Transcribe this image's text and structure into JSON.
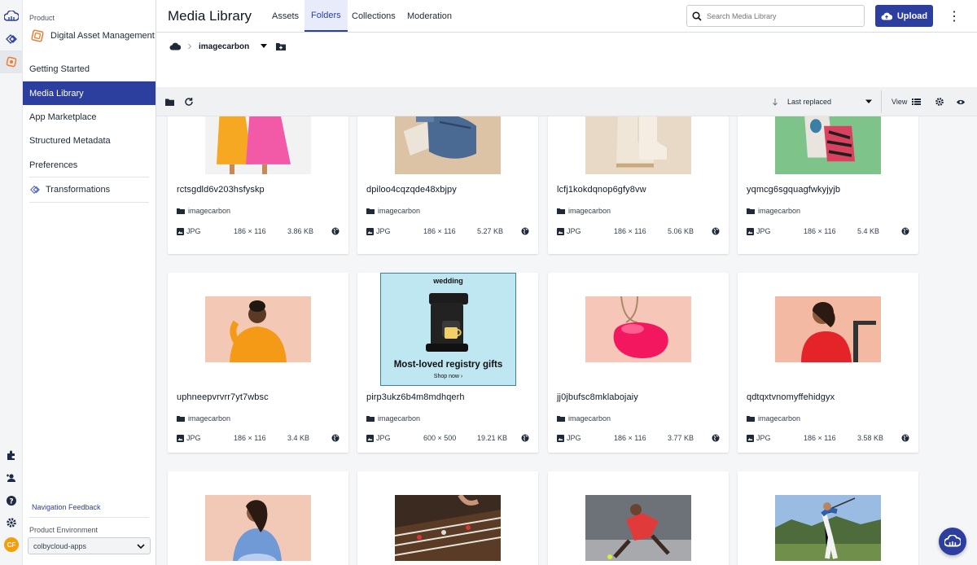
{
  "app": {
    "product_label": "Product",
    "product_name": "Digital Asset Management"
  },
  "sidebar": {
    "items": [
      {
        "label": "Getting Started"
      },
      {
        "label": "Media Library"
      },
      {
        "label": "App Marketplace"
      },
      {
        "label": "Structured Metadata"
      },
      {
        "label": "Preferences"
      },
      {
        "label": "Transformations"
      }
    ],
    "nav_feedback": "Navigation Feedback",
    "env_label": "Product Environment",
    "env_value": "colbycloud-apps",
    "avatar_initials": "CF"
  },
  "header": {
    "title": "Media Library",
    "tabs": [
      {
        "label": "Assets"
      },
      {
        "label": "Folders"
      },
      {
        "label": "Collections"
      },
      {
        "label": "Moderation"
      }
    ],
    "search_placeholder": "Search Media Library",
    "upload_label": "Upload"
  },
  "breadcrumb": {
    "folder": "imagecarbon"
  },
  "toolbar": {
    "sort_label": "Last replaced",
    "view_label": "View"
  },
  "assets": [
    {
      "name": "rctsgdld6v203hsfyskp",
      "folder": "imagecarbon",
      "format": "JPG",
      "dims": "186 × 116",
      "size": "3.86 KB"
    },
    {
      "name": "dpiloo4cqzqde48xbjpy",
      "folder": "imagecarbon",
      "format": "JPG",
      "dims": "186 × 116",
      "size": "5.27 KB"
    },
    {
      "name": "lcfj1kokdqnop6gfy8vw",
      "folder": "imagecarbon",
      "format": "JPG",
      "dims": "186 × 116",
      "size": "5.06 KB"
    },
    {
      "name": "yqmcg6sgquagfwkyjyjb",
      "folder": "imagecarbon",
      "format": "JPG",
      "dims": "186 × 116",
      "size": "5.4 KB"
    },
    {
      "name": "uphneepvrvrr7yt7wbsc",
      "folder": "imagecarbon",
      "format": "JPG",
      "dims": "186 × 116",
      "size": "3.4 KB"
    },
    {
      "name": "pirp3ukz6b4m8mdhqerh",
      "folder": "imagecarbon",
      "format": "JPG",
      "dims": "600 × 500",
      "size": "19.21 KB",
      "ad": {
        "brand": "wedding",
        "headline": "Most-loved registry gifts",
        "cta": "Shop now ›"
      }
    },
    {
      "name": "jj0jbufsc8mklabojaiy",
      "folder": "imagecarbon",
      "format": "JPG",
      "dims": "186 × 116",
      "size": "3.77 KB"
    },
    {
      "name": "qdtqxtvnomyffehidgyx",
      "folder": "imagecarbon",
      "format": "JPG",
      "dims": "186 × 116",
      "size": "3.58 KB"
    },
    {
      "name": "",
      "folder": "",
      "format": "",
      "dims": "",
      "size": ""
    },
    {
      "name": "",
      "folder": "",
      "format": "",
      "dims": "",
      "size": ""
    },
    {
      "name": "",
      "folder": "",
      "format": "",
      "dims": "",
      "size": ""
    },
    {
      "name": "",
      "folder": "",
      "format": "",
      "dims": "",
      "size": ""
    }
  ]
}
